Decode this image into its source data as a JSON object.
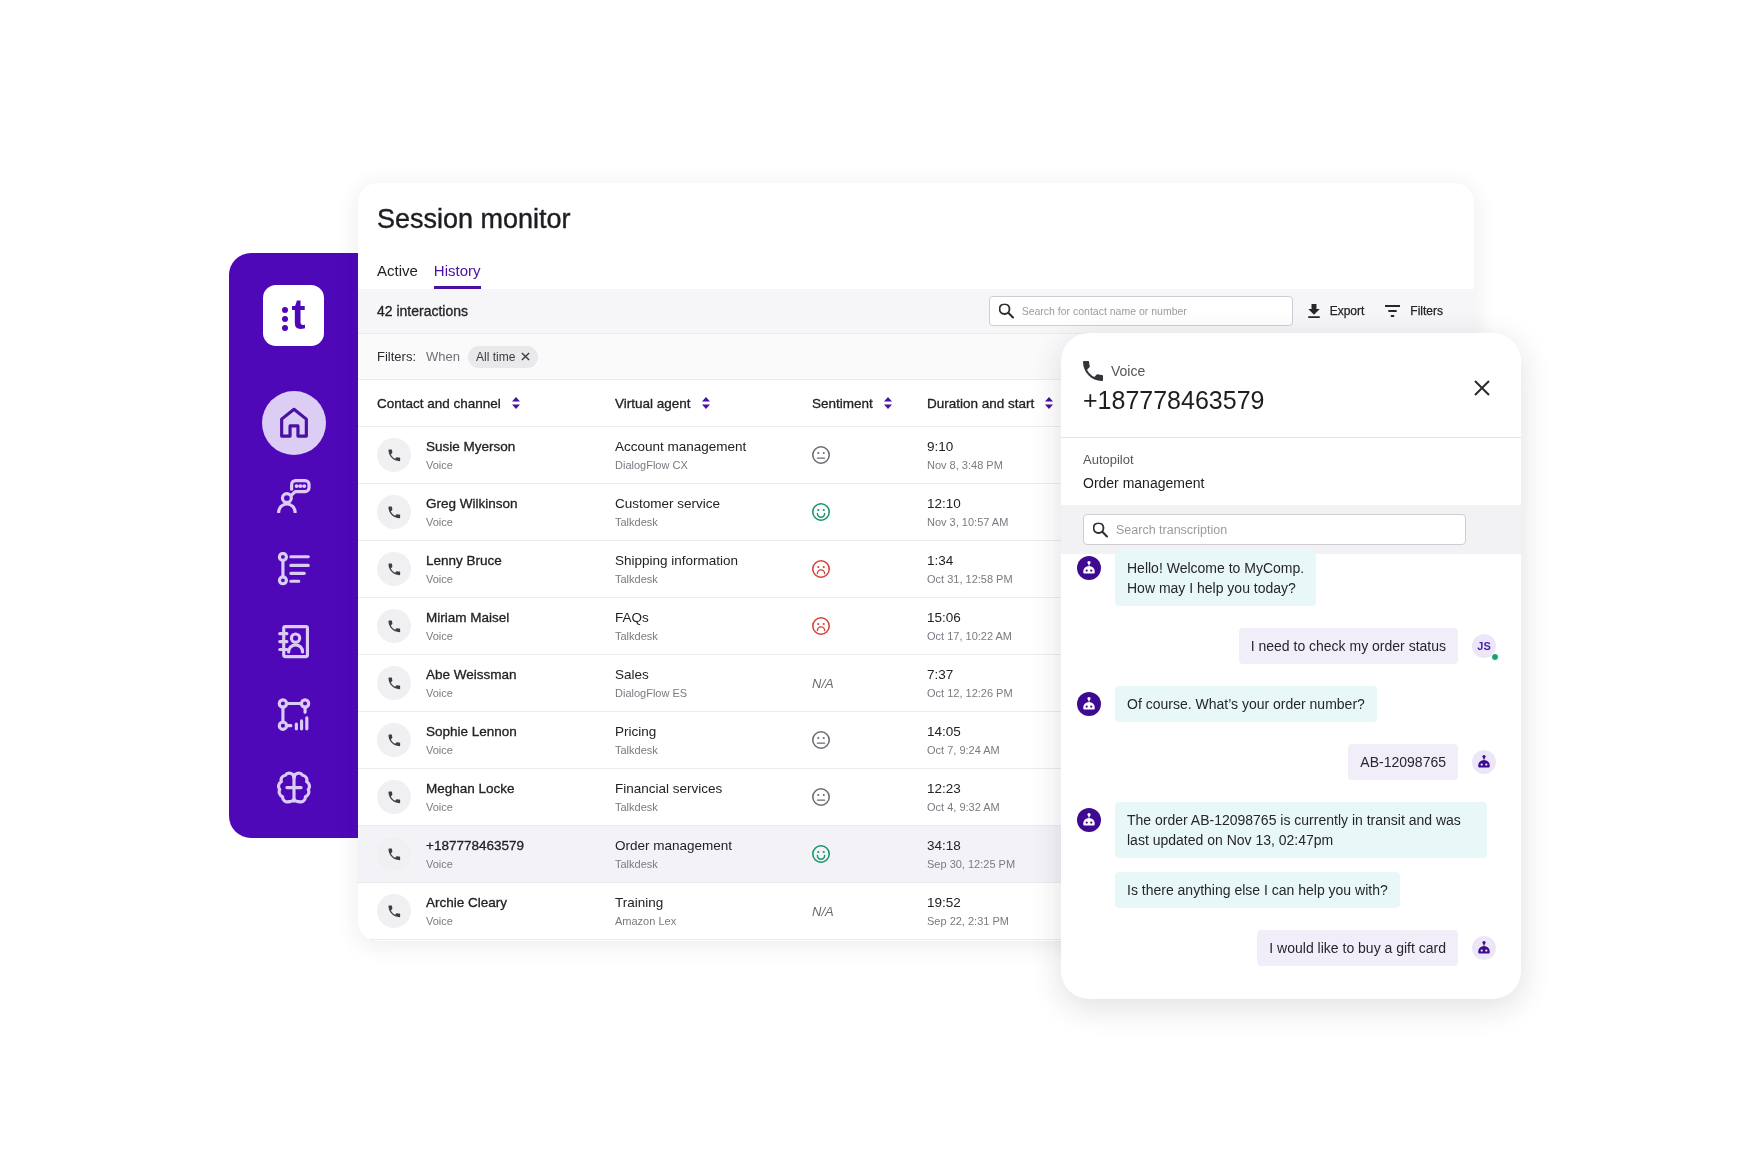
{
  "sidebar": {
    "logo": "t",
    "items": [
      {
        "selected": true
      },
      {
        "selected": false
      },
      {
        "selected": false
      },
      {
        "selected": false
      },
      {
        "selected": false
      },
      {
        "selected": false
      }
    ]
  },
  "session_monitor": {
    "title": "Session monitor",
    "tabs": [
      {
        "label": "Active",
        "selected": false
      },
      {
        "label": "History",
        "selected": true
      }
    ],
    "toolbar": {
      "count": "42 interactions",
      "search": {
        "placeholder": "Search for contact name or number"
      },
      "buttons": [
        "Export",
        "Filters"
      ]
    },
    "filters": {
      "label": "Filters:",
      "field": "When",
      "chips": [
        "All time"
      ]
    },
    "table": {
      "columns": [
        "Contact and channel",
        "Virtual agent",
        "Sentiment",
        "Duration and start"
      ],
      "rows": [
        {
          "contact": "Susie Myerson",
          "channel": "Voice",
          "agent": "Account management",
          "platform": "DialogFlow CX",
          "sentiment": {
            "kind": "neutral"
          },
          "duration": "9:10",
          "start": "Nov 8, 3:48 PM",
          "selected": false
        },
        {
          "contact": "Greg Wilkinson",
          "channel": "Voice",
          "agent": "Customer service",
          "platform": "Talkdesk",
          "sentiment": {
            "kind": "positive"
          },
          "duration": "12:10",
          "start": "Nov 3, 10:57 AM",
          "selected": false
        },
        {
          "contact": "Lenny Bruce",
          "channel": "Voice",
          "agent": "Shipping information",
          "platform": "Talkdesk",
          "sentiment": {
            "kind": "negative"
          },
          "duration": "1:34",
          "start": "Oct 31, 12:58 PM",
          "selected": false
        },
        {
          "contact": "Miriam Maisel",
          "channel": "Voice",
          "agent": "FAQs",
          "platform": "Talkdesk",
          "sentiment": {
            "kind": "negative"
          },
          "duration": "15:06",
          "start": "Oct 17, 10:22 AM",
          "selected": false
        },
        {
          "contact": "Abe Weissman",
          "channel": "Voice",
          "agent": "Sales",
          "platform": "DialogFlow ES",
          "sentiment": {
            "kind": "text",
            "label": "N/A"
          },
          "duration": "7:37",
          "start": "Oct 12, 12:26 PM",
          "selected": false
        },
        {
          "contact": "Sophie Lennon",
          "channel": "Voice",
          "agent": "Pricing",
          "platform": "Talkdesk",
          "sentiment": {
            "kind": "neutral"
          },
          "duration": "14:05",
          "start": "Oct 7, 9:24 AM",
          "selected": false
        },
        {
          "contact": "Meghan Locke",
          "channel": "Voice",
          "agent": "Financial services",
          "platform": "Talkdesk",
          "sentiment": {
            "kind": "neutral"
          },
          "duration": "12:23",
          "start": "Oct 4, 9:32 AM",
          "selected": false
        },
        {
          "contact": "+187778463579",
          "channel": "Voice",
          "agent": "Order management",
          "platform": "Talkdesk",
          "sentiment": {
            "kind": "positive"
          },
          "duration": "34:18",
          "start": "Sep 30, 12:25 PM",
          "selected": true
        },
        {
          "contact": "Archie Cleary",
          "channel": "Voice",
          "agent": "Training",
          "platform": "Amazon Lex",
          "sentiment": {
            "kind": "text",
            "label": "N/A"
          },
          "duration": "19:52",
          "start": "Sep 22, 2:31 PM",
          "selected": false
        }
      ]
    }
  },
  "transcript": {
    "channel": "Voice",
    "number": "+187778463579",
    "section": {
      "label": "Autopilot",
      "value": "Order management"
    },
    "search": {
      "placeholder": "Search transcription"
    },
    "messages": [
      {
        "kind": "bot",
        "text": "Hello! Welcome to MyComp.\nHow may I help you today?",
        "avatar": {
          "kind": "bot"
        }
      },
      {
        "kind": "user",
        "text": "I need to check my order status",
        "avatar": {
          "kind": "initials",
          "text": "JS",
          "online": true
        }
      },
      {
        "kind": "bot",
        "text": "Of course. What’s your order number?",
        "avatar": {
          "kind": "bot"
        }
      },
      {
        "kind": "user",
        "text": "AB-12098765",
        "avatar": {
          "kind": "bot"
        }
      },
      {
        "kind": "bot",
        "text": "The order AB-12098765 is currently in transit and was last updated on Nov 13, 02:47pm",
        "avatar": {
          "kind": "bot"
        }
      },
      {
        "kind": "bot",
        "text": "Is there anything else I can help you with?"
      },
      {
        "kind": "user",
        "text": "I would like to buy a gift card",
        "avatar": {
          "kind": "bot"
        }
      }
    ]
  }
}
